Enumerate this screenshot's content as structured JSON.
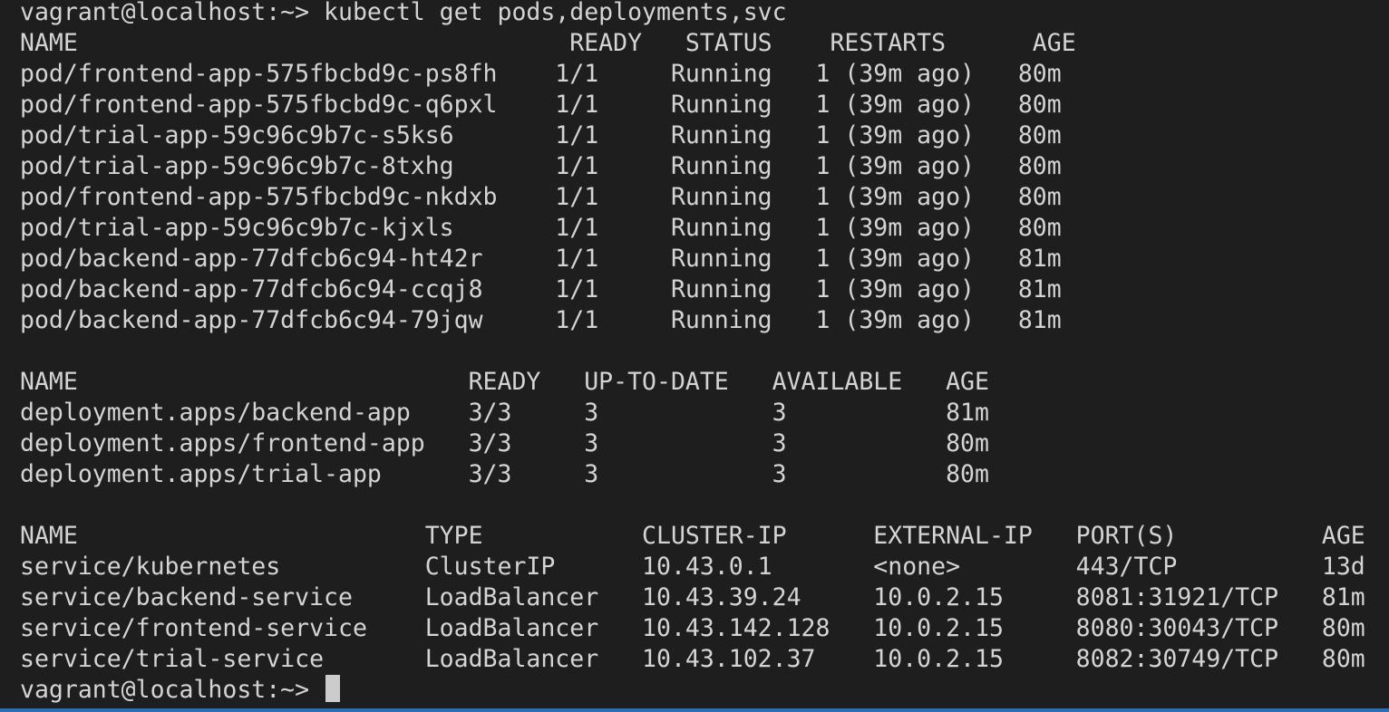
{
  "terminal": {
    "lines": [
      "vagrant@localhost:~> kubectl get pods,deployments,svc",
      "NAME                                  READY   STATUS    RESTARTS      AGE",
      "pod/frontend-app-575fbcbd9c-ps8fh    1/1     Running   1 (39m ago)   80m",
      "pod/frontend-app-575fbcbd9c-q6pxl    1/1     Running   1 (39m ago)   80m",
      "pod/trial-app-59c96c9b7c-s5ks6       1/1     Running   1 (39m ago)   80m",
      "pod/trial-app-59c96c9b7c-8txhg       1/1     Running   1 (39m ago)   80m",
      "pod/frontend-app-575fbcbd9c-nkdxb    1/1     Running   1 (39m ago)   80m",
      "pod/trial-app-59c96c9b7c-kjxls       1/1     Running   1 (39m ago)   80m",
      "pod/backend-app-77dfcb6c94-ht42r     1/1     Running   1 (39m ago)   81m",
      "pod/backend-app-77dfcb6c94-ccqj8     1/1     Running   1 (39m ago)   81m",
      "pod/backend-app-77dfcb6c94-79jqw     1/1     Running   1 (39m ago)   81m",
      "",
      "NAME                           READY   UP-TO-DATE   AVAILABLE   AGE",
      "deployment.apps/backend-app    3/3     3            3           81m",
      "deployment.apps/frontend-app   3/3     3            3           80m",
      "deployment.apps/trial-app      3/3     3            3           80m",
      "",
      "NAME                        TYPE           CLUSTER-IP      EXTERNAL-IP   PORT(S)          AGE",
      "service/kubernetes          ClusterIP      10.43.0.1       <none>        443/TCP          13d",
      "service/backend-service     LoadBalancer   10.43.39.24     10.0.2.15     8081:31921/TCP   81m",
      "service/frontend-service    LoadBalancer   10.43.142.128   10.0.2.15     8080:30043/TCP   80m",
      "service/trial-service       LoadBalancer   10.43.102.37    10.0.2.15     8082:30749/TCP   80m"
    ],
    "prompt": "vagrant@localhost:~> "
  },
  "colors": {
    "background": "#1e1e1e",
    "text": "#d4d4d4",
    "cursor": "#cccccc",
    "status_bar": "#2f6db5"
  }
}
